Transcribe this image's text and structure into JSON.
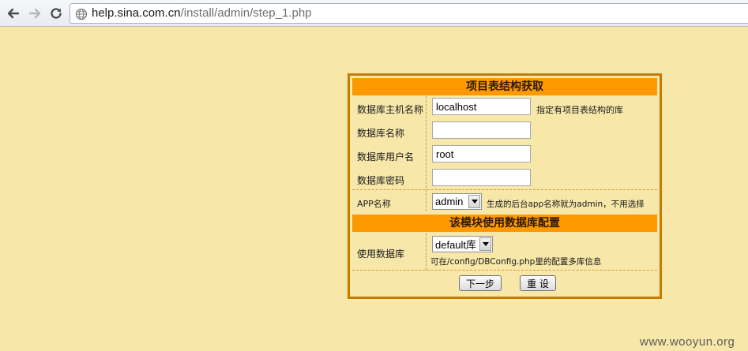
{
  "browser": {
    "url_host": "help.sina.com.cn",
    "url_path": "/install/admin/step_1.php"
  },
  "form": {
    "section1_title": "项目表结构获取",
    "db_host_label": "数据库主机名称",
    "db_host_value": "localhost",
    "db_host_hint": "指定有项目表结构的库",
    "db_name_label": "数据库名称",
    "db_name_value": "",
    "db_user_label": "数据库用户名",
    "db_user_value": "root",
    "db_pass_label": "数据库密码",
    "db_pass_value": "",
    "app_label": "APP名称",
    "app_selected": "admin",
    "app_hint": "生成的后台app名称就为admin，不用选择",
    "section2_title": "该模块使用数据库配置",
    "use_db_label": "使用数据库",
    "use_db_selected": "default库",
    "use_db_hint": "可在/config/DBConfig.php里的配置多库信息",
    "next_button": "下一步",
    "reset_button": "重 设"
  },
  "watermark": "www.wooyun.org",
  "colors": {
    "page_bg": "#f7e7a9",
    "header_bg": "#ff9900",
    "panel_border": "#c87a00"
  }
}
